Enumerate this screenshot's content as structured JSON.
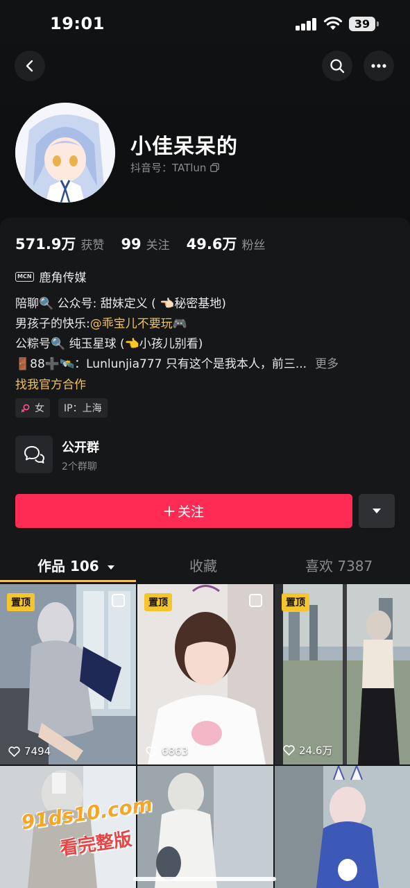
{
  "status_bar": {
    "time": "19:01",
    "battery": "39"
  },
  "profile": {
    "name": "小佳呆呆的",
    "douyin_id": "抖音号：TATlun"
  },
  "stats": [
    {
      "num": "571.9万",
      "label": "获赞"
    },
    {
      "num": "99",
      "label": "关注"
    },
    {
      "num": "49.6万",
      "label": "粉丝"
    }
  ],
  "mcn": {
    "badge": "MCN",
    "name": "鹿角传媒"
  },
  "bio": {
    "line1": "陪聊🔍 公众号:  甜妹定义 ( 👈🏻秘密基地)",
    "line2_prefix": "男孩子的快乐:",
    "line2_link": "@乖宝儿不要玩",
    "line2_suffix": "🎮",
    "line3": "公粽号🔍 纯玉星球 (👈小孩儿别看)",
    "line4": "🚪88➕🛰️：Lunlunjia777  只有这个是我本人，前三...",
    "more": "更多",
    "official": "找我官方合作"
  },
  "tags": {
    "gender": "女",
    "ip": "IP：上海"
  },
  "group": {
    "title": "公开群",
    "subtitle": "2个群聊"
  },
  "follow": {
    "label": "关注"
  },
  "tabs": [
    {
      "label": "作品 106"
    },
    {
      "label": "收藏"
    },
    {
      "label": "喜欢 7387"
    }
  ],
  "grid": [
    {
      "pin": "置顶",
      "likes": "7494"
    },
    {
      "pin": "置顶",
      "likes": "6863"
    },
    {
      "pin": "置顶",
      "likes": "24.6万"
    }
  ],
  "watermark": {
    "line1": "91ds10.com",
    "line2": "看完整版"
  },
  "colors": {
    "accent": "#fe2c55",
    "link": "#f1c15b",
    "pin": "#f5c52d"
  }
}
